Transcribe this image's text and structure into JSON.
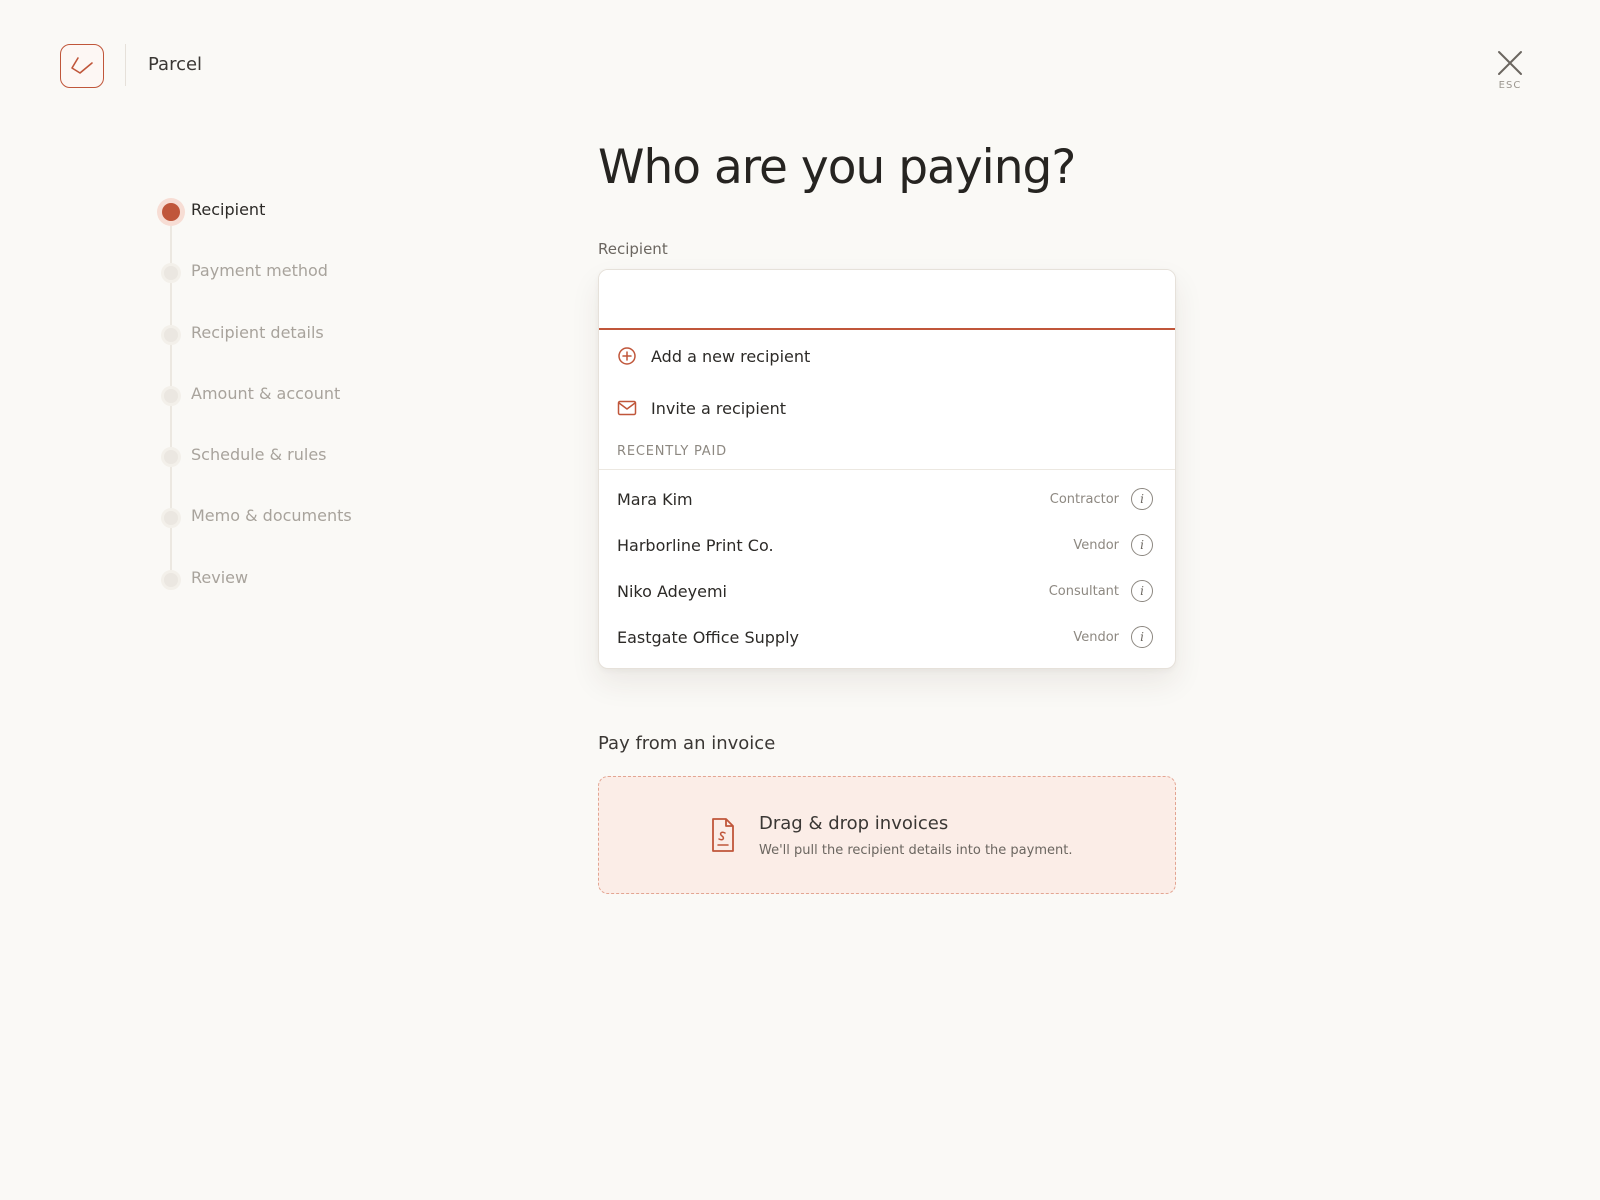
{
  "header": {
    "brand": "Parcel",
    "close_hint": "ESC"
  },
  "stepper": {
    "steps": [
      {
        "label": "Recipient",
        "active": true
      },
      {
        "label": "Payment method",
        "active": false
      },
      {
        "label": "Recipient details",
        "active": false
      },
      {
        "label": "Amount & account",
        "active": false
      },
      {
        "label": "Schedule & rules",
        "active": false
      },
      {
        "label": "Memo & documents",
        "active": false
      },
      {
        "label": "Review",
        "active": false
      }
    ]
  },
  "main": {
    "title": "Who are you paying?",
    "recipient_label": "Recipient",
    "recipient_value": "",
    "actions": [
      {
        "label": "Add a new recipient",
        "icon": "plus-circle-icon"
      },
      {
        "label": "Invite a recipient",
        "icon": "mail-icon"
      }
    ],
    "recent_heading": "RECENTLY PAID",
    "recent": [
      {
        "name": "Mara Kim",
        "type": "Contractor"
      },
      {
        "name": "Harborline Print Co.",
        "type": "Vendor"
      },
      {
        "name": "Niko Adeyemi",
        "type": "Consultant"
      },
      {
        "name": "Eastgate Office Supply",
        "type": "Vendor"
      }
    ],
    "invoice_heading": "Pay from an invoice",
    "dropzone": {
      "title": "Drag & drop invoices",
      "subtitle": "We'll pull the recipient details into the payment."
    }
  },
  "colors": {
    "accent": "#c0563a",
    "background": "#faf9f6",
    "dropzone_bg": "#fbede7"
  }
}
